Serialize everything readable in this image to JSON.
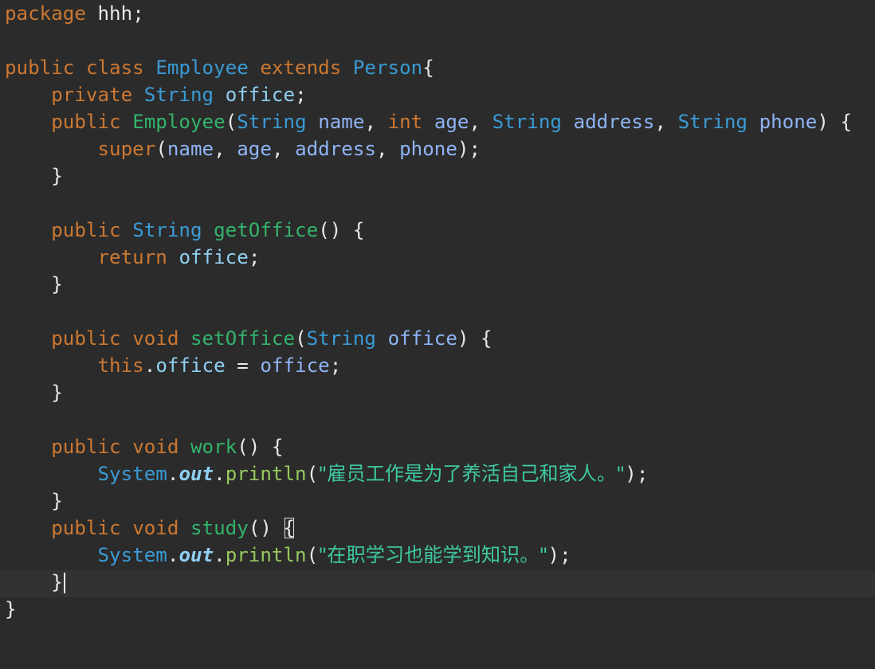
{
  "lines": [
    {
      "id": "l1",
      "tokens": [
        {
          "t": "package",
          "c": "kw"
        },
        {
          "t": " ",
          "c": "plain"
        },
        {
          "t": "hhh",
          "c": "plain"
        },
        {
          "t": ";",
          "c": "plain"
        }
      ]
    },
    {
      "id": "l2",
      "tokens": []
    },
    {
      "id": "l3",
      "tokens": [
        {
          "t": "public",
          "c": "kw"
        },
        {
          "t": " ",
          "c": "plain"
        },
        {
          "t": "class",
          "c": "kw"
        },
        {
          "t": " ",
          "c": "plain"
        },
        {
          "t": "Employee",
          "c": "cls"
        },
        {
          "t": " ",
          "c": "plain"
        },
        {
          "t": "extends",
          "c": "kw"
        },
        {
          "t": " ",
          "c": "plain"
        },
        {
          "t": "Person",
          "c": "cls"
        },
        {
          "t": "{",
          "c": "plain"
        }
      ]
    },
    {
      "id": "l4",
      "tokens": [
        {
          "t": "    ",
          "c": "plain"
        },
        {
          "t": "private",
          "c": "kw"
        },
        {
          "t": " ",
          "c": "plain"
        },
        {
          "t": "String",
          "c": "type"
        },
        {
          "t": " ",
          "c": "plain"
        },
        {
          "t": "office",
          "c": "fld"
        },
        {
          "t": ";",
          "c": "plain"
        }
      ]
    },
    {
      "id": "l5",
      "tokens": [
        {
          "t": "    ",
          "c": "plain"
        },
        {
          "t": "public",
          "c": "kw"
        },
        {
          "t": " ",
          "c": "plain"
        },
        {
          "t": "Employee",
          "c": "mname"
        },
        {
          "t": "(",
          "c": "plain"
        },
        {
          "t": "String",
          "c": "type"
        },
        {
          "t": " ",
          "c": "plain"
        },
        {
          "t": "name",
          "c": "param"
        },
        {
          "t": ", ",
          "c": "plain"
        },
        {
          "t": "int",
          "c": "kw"
        },
        {
          "t": " ",
          "c": "plain"
        },
        {
          "t": "age",
          "c": "param"
        },
        {
          "t": ", ",
          "c": "plain"
        },
        {
          "t": "String",
          "c": "type"
        },
        {
          "t": " ",
          "c": "plain"
        },
        {
          "t": "address",
          "c": "param"
        },
        {
          "t": ", ",
          "c": "plain"
        },
        {
          "t": "String",
          "c": "type"
        },
        {
          "t": " ",
          "c": "plain"
        },
        {
          "t": "phone",
          "c": "param"
        },
        {
          "t": ") {",
          "c": "plain"
        }
      ]
    },
    {
      "id": "l6",
      "tokens": [
        {
          "t": "        ",
          "c": "plain"
        },
        {
          "t": "super",
          "c": "kw"
        },
        {
          "t": "(",
          "c": "plain"
        },
        {
          "t": "name",
          "c": "param"
        },
        {
          "t": ", ",
          "c": "plain"
        },
        {
          "t": "age",
          "c": "param"
        },
        {
          "t": ", ",
          "c": "plain"
        },
        {
          "t": "address",
          "c": "param"
        },
        {
          "t": ", ",
          "c": "plain"
        },
        {
          "t": "phone",
          "c": "param"
        },
        {
          "t": ");",
          "c": "plain"
        }
      ]
    },
    {
      "id": "l7",
      "tokens": [
        {
          "t": "    }",
          "c": "plain"
        }
      ]
    },
    {
      "id": "l8",
      "tokens": []
    },
    {
      "id": "l9",
      "tokens": [
        {
          "t": "    ",
          "c": "plain"
        },
        {
          "t": "public",
          "c": "kw"
        },
        {
          "t": " ",
          "c": "plain"
        },
        {
          "t": "String",
          "c": "type"
        },
        {
          "t": " ",
          "c": "plain"
        },
        {
          "t": "getOffice",
          "c": "mname"
        },
        {
          "t": "() {",
          "c": "plain"
        }
      ]
    },
    {
      "id": "l10",
      "tokens": [
        {
          "t": "        ",
          "c": "plain"
        },
        {
          "t": "return",
          "c": "kw"
        },
        {
          "t": " ",
          "c": "plain"
        },
        {
          "t": "office",
          "c": "fld"
        },
        {
          "t": ";",
          "c": "plain"
        }
      ]
    },
    {
      "id": "l11",
      "tokens": [
        {
          "t": "    }",
          "c": "plain"
        }
      ]
    },
    {
      "id": "l12",
      "tokens": []
    },
    {
      "id": "l13",
      "tokens": [
        {
          "t": "    ",
          "c": "plain"
        },
        {
          "t": "public",
          "c": "kw"
        },
        {
          "t": " ",
          "c": "plain"
        },
        {
          "t": "void",
          "c": "kw"
        },
        {
          "t": " ",
          "c": "plain"
        },
        {
          "t": "setOffice",
          "c": "mname"
        },
        {
          "t": "(",
          "c": "plain"
        },
        {
          "t": "String",
          "c": "type"
        },
        {
          "t": " ",
          "c": "plain"
        },
        {
          "t": "office",
          "c": "param"
        },
        {
          "t": ") {",
          "c": "plain"
        }
      ]
    },
    {
      "id": "l14",
      "tokens": [
        {
          "t": "        ",
          "c": "plain"
        },
        {
          "t": "this",
          "c": "kw"
        },
        {
          "t": ".",
          "c": "plain"
        },
        {
          "t": "office",
          "c": "fld"
        },
        {
          "t": " = ",
          "c": "plain"
        },
        {
          "t": "office",
          "c": "param"
        },
        {
          "t": ";",
          "c": "plain"
        }
      ]
    },
    {
      "id": "l15",
      "tokens": [
        {
          "t": "    }",
          "c": "plain"
        }
      ]
    },
    {
      "id": "l16",
      "tokens": []
    },
    {
      "id": "l17",
      "tokens": [
        {
          "t": "    ",
          "c": "plain"
        },
        {
          "t": "public",
          "c": "kw"
        },
        {
          "t": " ",
          "c": "plain"
        },
        {
          "t": "void",
          "c": "kw"
        },
        {
          "t": " ",
          "c": "plain"
        },
        {
          "t": "work",
          "c": "mname"
        },
        {
          "t": "() {",
          "c": "plain"
        }
      ]
    },
    {
      "id": "l18",
      "tokens": [
        {
          "t": "        ",
          "c": "plain"
        },
        {
          "t": "System",
          "c": "cls"
        },
        {
          "t": ".",
          "c": "plain"
        },
        {
          "t": "out",
          "c": "static"
        },
        {
          "t": ".",
          "c": "plain"
        },
        {
          "t": "println",
          "c": "call"
        },
        {
          "t": "(",
          "c": "plain"
        },
        {
          "t": "\"雇员工作是为了养活自己和家人。\"",
          "c": "str cjk"
        },
        {
          "t": ");",
          "c": "plain"
        }
      ]
    },
    {
      "id": "l19",
      "tokens": [
        {
          "t": "    }",
          "c": "plain"
        }
      ]
    },
    {
      "id": "l20",
      "tokens": [
        {
          "t": "    ",
          "c": "plain"
        },
        {
          "t": "public",
          "c": "kw"
        },
        {
          "t": " ",
          "c": "plain"
        },
        {
          "t": "void",
          "c": "kw"
        },
        {
          "t": " ",
          "c": "plain"
        },
        {
          "t": "study",
          "c": "mname"
        },
        {
          "t": "() ",
          "c": "plain"
        },
        {
          "t": "{",
          "c": "plain brace-match"
        }
      ]
    },
    {
      "id": "l21",
      "tokens": [
        {
          "t": "        ",
          "c": "plain"
        },
        {
          "t": "System",
          "c": "cls"
        },
        {
          "t": ".",
          "c": "plain"
        },
        {
          "t": "out",
          "c": "static"
        },
        {
          "t": ".",
          "c": "plain"
        },
        {
          "t": "println",
          "c": "call"
        },
        {
          "t": "(",
          "c": "plain"
        },
        {
          "t": "\"在职学习也能学到知识。\"",
          "c": "str cjk"
        },
        {
          "t": ");",
          "c": "plain"
        }
      ]
    },
    {
      "id": "l22",
      "tokens": [
        {
          "t": "    }",
          "c": "plain"
        }
      ],
      "caret": true
    },
    {
      "id": "l23",
      "tokens": [
        {
          "t": "}",
          "c": "plain"
        }
      ]
    }
  ]
}
